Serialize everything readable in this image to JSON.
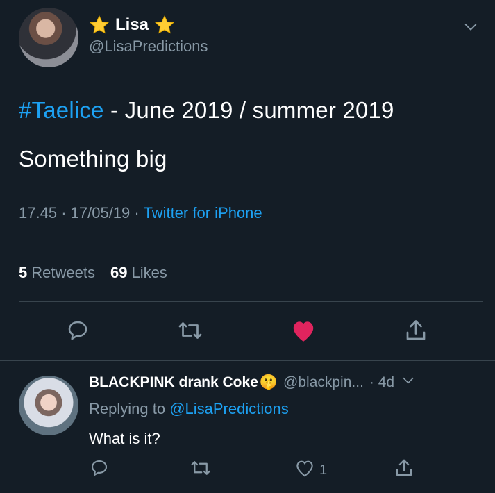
{
  "tweet": {
    "author_name": "Lisa",
    "author_handle": "@LisaPredictions",
    "hashtag": "#Taelice",
    "line1_rest": " - June 2019 / summer 2019",
    "line2": "Something big",
    "time": "17.45",
    "date": "17/05/19",
    "source": "Twitter for iPhone",
    "retweet_count": "5",
    "retweet_label": "Retweets",
    "like_count": "69",
    "like_label": "Likes",
    "liked": true
  },
  "reply": {
    "author_name": "BLACKPINK drank Coke",
    "author_emoji": "🤫",
    "author_handle": "@blackpin...",
    "age": "· 4d",
    "replying_prefix": "Replying to ",
    "replying_to": "@LisaPredictions",
    "text": "What is it?",
    "like_count": "1"
  },
  "icons": [
    "star-icon",
    "chevron-down-icon",
    "reply-icon",
    "retweet-icon",
    "heart-icon",
    "share-icon",
    "shush-emoji-icon"
  ],
  "colors": {
    "background": "#141d26",
    "accent": "#1da1f2",
    "secondary_text": "#8899a6",
    "liked_heart": "#e0245e",
    "divider": "#38444d"
  }
}
